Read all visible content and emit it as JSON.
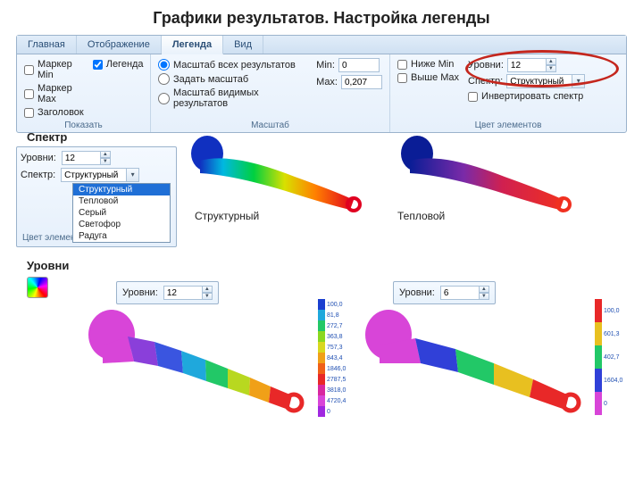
{
  "title": "Графики результатов. Настройка легенды",
  "tabs": {
    "t0": "Главная",
    "t1": "Отображение",
    "t2": "Легенда",
    "t3": "Вид"
  },
  "show": {
    "marker_min": "Маркер Min",
    "marker_max": "Маркер Max",
    "legend": "Легенда",
    "header": "Заголовок",
    "group": "Показать"
  },
  "scale": {
    "all": "Масштаб всех результатов",
    "set": "Задать масштаб",
    "visible": "Масштаб видимых результатов",
    "min_lbl": "Min:",
    "min_val": "0",
    "max_lbl": "Max:",
    "max_val": "0,207",
    "group": "Масштаб"
  },
  "colors": {
    "below": "Ниже Min",
    "above": "Выше Max",
    "levels_lbl": "Уровни:",
    "levels_val": "12",
    "spectrum_lbl": "Спектр:",
    "spectrum_val": "Структурный",
    "invert": "Инвертировать спектр",
    "group": "Цвет элементов"
  },
  "sections": {
    "spectrum": "Спектр",
    "levels": "Уровни"
  },
  "mini": {
    "levels_lbl": "Уровни:",
    "levels_val": "12",
    "spectrum_lbl": "Спектр:",
    "spectrum_val": "Структурный",
    "footer": "Цвет элементов",
    "opts": {
      "o0": "Структурный",
      "o1": "Тепловой",
      "o2": "Серый",
      "o3": "Светофор",
      "o4": "Радуга"
    }
  },
  "captions": {
    "structural": "Структурный",
    "thermal": "Тепловой"
  },
  "lp1": {
    "lbl": "Уровни:",
    "val": "12"
  },
  "lp2": {
    "lbl": "Уровни:",
    "val": "6"
  },
  "legend12": [
    "100,0",
    "81,8",
    "272,7",
    "363,8",
    "757,3",
    "843,4",
    "1846,0",
    "2787,5",
    "3818,0",
    "4720,4",
    "0"
  ],
  "legend6": [
    "100,0",
    "601,3",
    "402,7",
    "1604,0",
    "0"
  ]
}
